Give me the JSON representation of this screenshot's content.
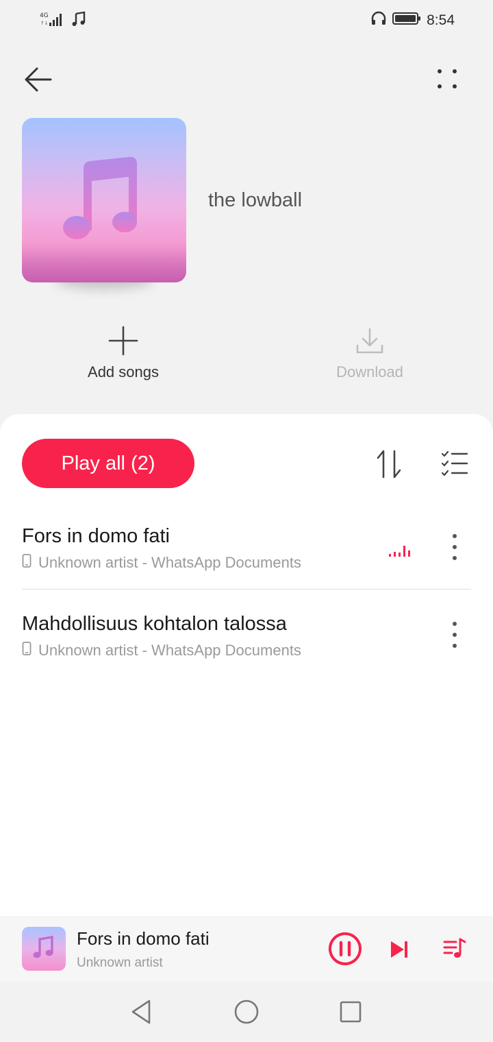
{
  "status_bar": {
    "network": "4G",
    "time": "8:54",
    "icons": [
      "signal-icon",
      "music-note-icon",
      "headphones-icon",
      "battery-icon"
    ]
  },
  "header": {
    "back_icon": "back-arrow-icon",
    "more_icon": "more-dots-icon"
  },
  "playlist": {
    "title": "the lowball",
    "cover_icon": "music-note-icon"
  },
  "actions": {
    "add_songs": "Add songs",
    "download": "Download"
  },
  "list": {
    "play_all_label": "Play all (2)",
    "sort_icon": "sort-icon",
    "multi_select_icon": "multi-select-icon",
    "songs": [
      {
        "title": "Fors in domo fati",
        "subtitle": "Unknown artist - WhatsApp Documents",
        "playing": true
      },
      {
        "title": "Mahdollisuus kohtalon talossa",
        "subtitle": "Unknown artist - WhatsApp Documents",
        "playing": false
      }
    ]
  },
  "mini_player": {
    "title": "Fors in domo fati",
    "artist": "Unknown artist"
  },
  "colors": {
    "accent": "#f8234c",
    "background": "#f2f2f2",
    "sheet": "#ffffff",
    "disabled_text": "#b5b5b5"
  }
}
